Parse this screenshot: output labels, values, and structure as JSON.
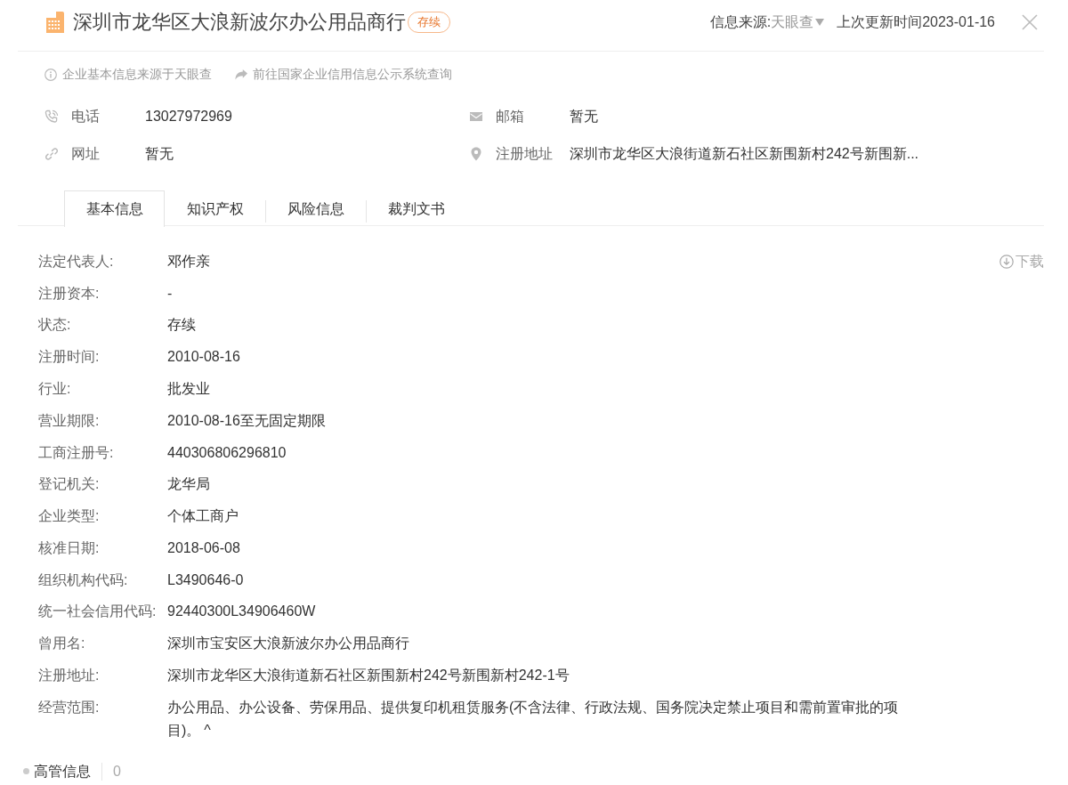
{
  "header": {
    "title": "深圳市龙华区大浪新波尔办公用品商行",
    "status_badge": "存续",
    "source_label": "信息来源:",
    "source_value": "天眼查",
    "updated": "上次更新时间2023-01-16"
  },
  "notices": [
    {
      "kind": "info",
      "text": "企业基本信息来源于天眼查"
    },
    {
      "kind": "link",
      "text": "前往国家企业信用信息公示系统查询"
    }
  ],
  "contacts": [
    {
      "kind": "phone",
      "label": "电话",
      "value": "13027972969"
    },
    {
      "kind": "email",
      "label": "邮箱",
      "value": "暂无"
    },
    {
      "kind": "website",
      "label": "网址",
      "value": "暂无"
    },
    {
      "kind": "address",
      "label": "注册地址",
      "value": "深圳市龙华区大浪街道新石社区新围新村242号新围新..."
    }
  ],
  "tabs": [
    {
      "label": "基本信息",
      "selected": true
    },
    {
      "label": "知识产权",
      "selected": false
    },
    {
      "label": "风险信息",
      "selected": false
    },
    {
      "label": "裁判文书",
      "selected": false
    }
  ],
  "download": "下载",
  "details": [
    {
      "label": "法定代表人:",
      "value": "邓作亲"
    },
    {
      "label": "注册资本:",
      "value": "-"
    },
    {
      "label": "状态:",
      "value": "存续"
    },
    {
      "label": "注册时间:",
      "value": "2010-08-16"
    },
    {
      "label": "行业:",
      "value": "批发业"
    },
    {
      "label": "营业期限:",
      "value": "2010-08-16至无固定期限"
    },
    {
      "label": "工商注册号:",
      "value": "440306806296810"
    },
    {
      "label": "登记机关:",
      "value": "龙华局"
    },
    {
      "label": "企业类型:",
      "value": "个体工商户"
    },
    {
      "label": "核准日期:",
      "value": "2018-06-08"
    },
    {
      "label": "组织机构代码:",
      "value": "L3490646-0"
    },
    {
      "label": "统一社会信用代码:",
      "value": "92440300L34906460W"
    },
    {
      "label": "曾用名:",
      "value": "深圳市宝安区大浪新波尔办公用品商行"
    },
    {
      "label": "注册地址:",
      "value": "深圳市龙华区大浪街道新石社区新围新村242号新围新村242-1号"
    },
    {
      "label": "经营范围:",
      "value": "办公用品、办公设备、劳保用品、提供复印机租赁服务(不含法律、行政法规、国务院决定禁止项目和需前置审批的项目)。",
      "toggle": "^"
    }
  ],
  "section": {
    "title": "高管信息",
    "count": "0"
  }
}
